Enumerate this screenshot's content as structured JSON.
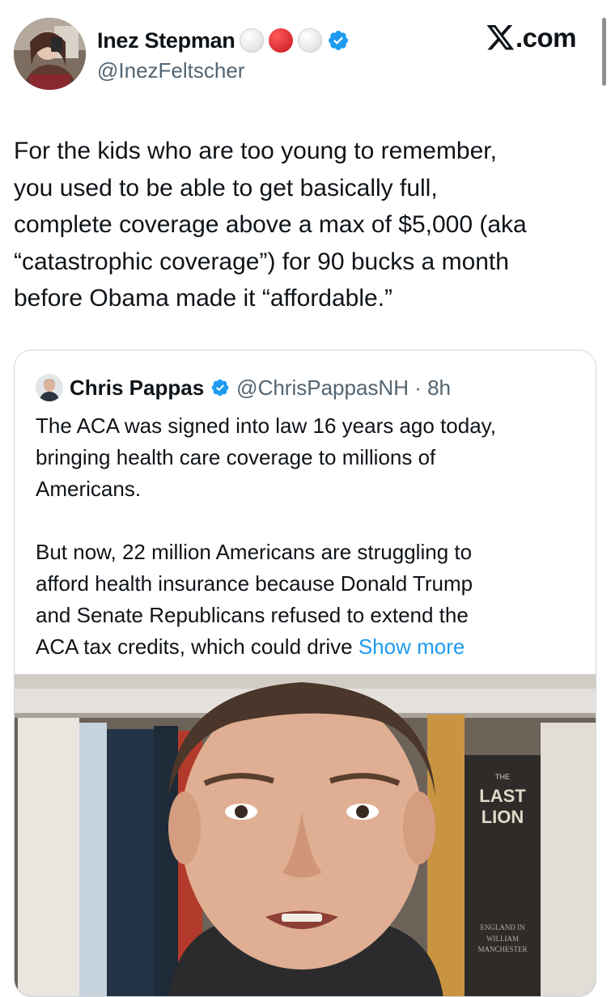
{
  "brand": {
    "label": ".com",
    "logo_icon": "x-logo-icon"
  },
  "author": {
    "name": "Inez Stepman",
    "handle": "@InezFeltscher",
    "badges": [
      {
        "icon": "white-circle-icon",
        "color": "#e6e6e6"
      },
      {
        "icon": "red-circle-icon",
        "color": "#d92b2b"
      },
      {
        "icon": "white-circle-icon",
        "color": "#e6e6e6"
      },
      {
        "icon": "verified-badge-icon",
        "color": "#1d9bf0"
      }
    ]
  },
  "tweet": {
    "lines": [
      "For the kids who are too young to remember,",
      "you used to be able to get basically full,",
      "complete coverage above a max of $5,000 (aka",
      "“catastrophic coverage”) for 90 bucks a month",
      "before Obama made it “affordable.”"
    ]
  },
  "quote": {
    "name": "Chris Pappas",
    "handle_time": "@ChrisPappasNH · 8h",
    "lines": [
      "The ACA was signed into law 16 years ago today,",
      "bringing health care coverage to millions of",
      "Americans.",
      "",
      "But now, 22 million Americans are struggling to",
      "afford health insurance because Donald Trump",
      "and Senate Republicans refused to extend the"
    ],
    "last_line": "ACA tax credits, which could drive ",
    "show_more": "Show more",
    "media": {
      "book_title_line1": "LAST",
      "book_title_line2": "LION",
      "book_title_prefix": "THE",
      "book_author_1": "ENGLAND IN",
      "book_author_2": "WILLIAM",
      "book_author_3": "MANCHESTER"
    }
  },
  "colors": {
    "accent": "#1d9bf0",
    "text": "#0f1419",
    "secondary": "#536471"
  }
}
